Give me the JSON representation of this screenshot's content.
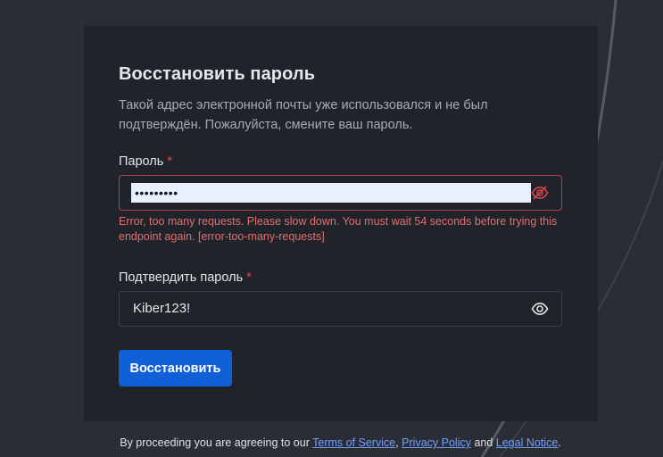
{
  "form": {
    "title": "Восстановить пароль",
    "subtitle": "Такой адрес электронной почты уже использовался и не был подтверждён. Пожалуйста, смените ваш пароль.",
    "password": {
      "label": "Пароль",
      "required_mark": "*",
      "masked_value": "•••••••••",
      "state": "error",
      "icon": "eye-slash-icon"
    },
    "error": "Error, too many requests. Please slow down. You must wait 54 seconds before trying this endpoint again. [error-too-many-requests]",
    "confirm_password": {
      "label": "Подтвердить пароль",
      "required_mark": "*",
      "value": "Kiber123!",
      "icon": "eye-icon"
    },
    "submit_label": "Восстановить"
  },
  "footer": {
    "prefix": "By proceeding you are agreeing to our ",
    "terms": "Terms of Service",
    "sep1": ", ",
    "privacy": "Privacy Policy",
    "sep2": " and ",
    "legal": "Legal Notice",
    "suffix": "."
  },
  "colors": {
    "page_bg": "#2b2d36",
    "card_bg": "#21232b",
    "accent": "#1160d8",
    "error": "#e0706f",
    "required": "#e5484d",
    "link": "#6fa0ff"
  }
}
